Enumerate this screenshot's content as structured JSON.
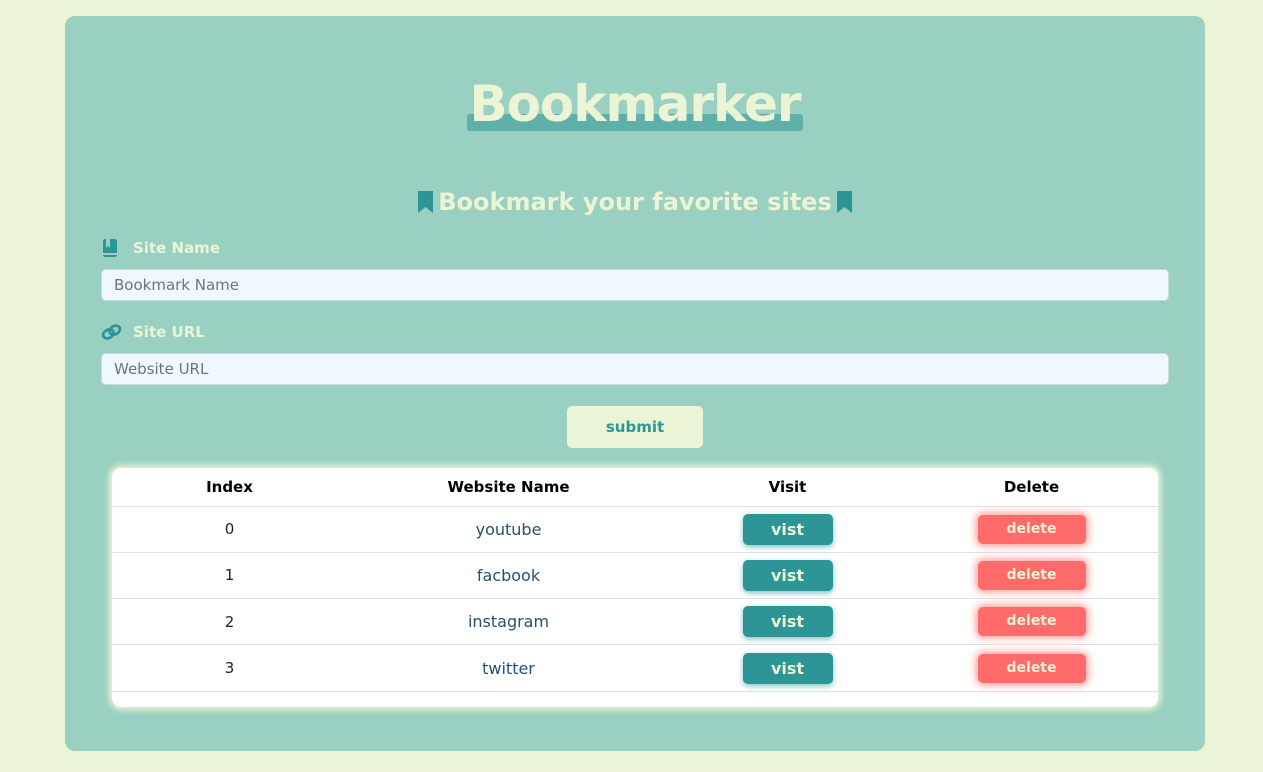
{
  "header": {
    "title": "Bookmarker"
  },
  "subtitle": {
    "text": "Bookmark your favorite sites"
  },
  "form": {
    "site_name": {
      "label": "Site Name",
      "placeholder": "Bookmark Name",
      "value": ""
    },
    "site_url": {
      "label": "Site URL",
      "placeholder": "Website URL",
      "value": ""
    },
    "submit_label": "submit"
  },
  "table": {
    "columns": [
      "Index",
      "Website Name",
      "Visit",
      "Delete"
    ],
    "rows": [
      {
        "index": "0",
        "name": "youtube",
        "visit_label": "vist",
        "delete_label": "delete"
      },
      {
        "index": "1",
        "name": "facbook",
        "visit_label": "vist",
        "delete_label": "delete"
      },
      {
        "index": "2",
        "name": "instagram",
        "visit_label": "vist",
        "delete_label": "delete"
      },
      {
        "index": "3",
        "name": "twitter",
        "visit_label": "vist",
        "delete_label": "delete"
      }
    ]
  },
  "icons": {
    "subtitle_left": "bookmark-icon",
    "subtitle_right": "bookmark-icon",
    "site_name": "book-icon",
    "site_url": "link-icon"
  },
  "colors": {
    "page_bg": "#ecf4d6",
    "card_bg": "#9ad0c2",
    "accent": "#2d9596",
    "input_bg": "#f0f8ff",
    "delete": "#ff6b6b",
    "link_text": "#265073"
  }
}
